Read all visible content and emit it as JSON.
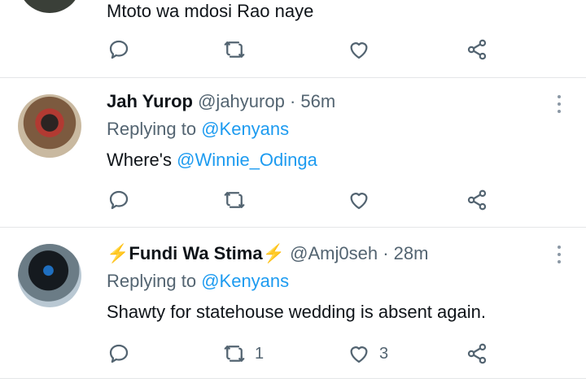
{
  "tweets": [
    {
      "text": "Mtoto wa mdosi Rao naye",
      "stats": {
        "replies": "",
        "retweets": "",
        "likes": ""
      }
    },
    {
      "name": "Jah Yurop",
      "handle": "@jahyurop",
      "separator": "·",
      "time": "56m",
      "replying_label": "Replying to",
      "replying_to": "@Kenyans",
      "text_prefix": "Where's ",
      "text_mention": "@Winnie_Odinga",
      "stats": {
        "replies": "",
        "retweets": "",
        "likes": ""
      }
    },
    {
      "name_bolt_left": "⚡",
      "name": "Fundi Wa Stima",
      "name_bolt_right": "⚡",
      "handle": "@Amj0seh",
      "separator": "·",
      "time": "28m",
      "replying_label": "Replying to",
      "replying_to": "@Kenyans",
      "text": "Shawty for statehouse wedding is absent again.",
      "stats": {
        "replies": "",
        "retweets": "1",
        "likes": "3"
      }
    }
  ],
  "icons": {
    "reply": "reply-icon",
    "retweet": "retweet-icon",
    "like": "heart-icon",
    "share": "share-icon",
    "more": "more-options-icon"
  },
  "colors": {
    "text": "#0f1419",
    "secondary": "#536471",
    "link": "#1d9bf0",
    "bolt": "#f4a81d",
    "divider": "#e4e6e8"
  }
}
